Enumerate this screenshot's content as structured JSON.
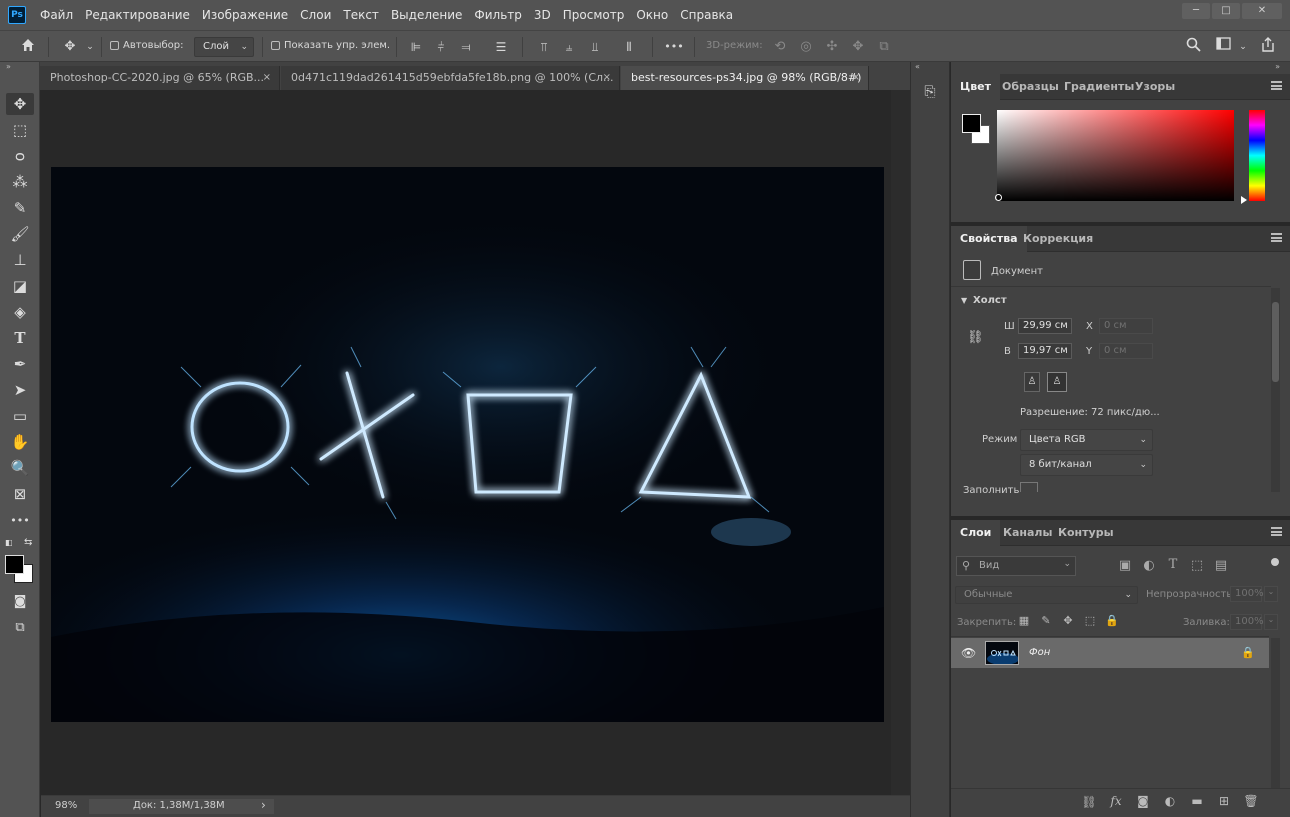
{
  "app": {
    "logo": "Ps"
  },
  "menubar": {
    "items": [
      "Файл",
      "Редактирование",
      "Изображение",
      "Слои",
      "Текст",
      "Выделение",
      "Фильтр",
      "3D",
      "Просмотр",
      "Окно",
      "Справка"
    ],
    "window_controls": [
      "minimize-icon",
      "maximize-icon",
      "close-icon"
    ]
  },
  "options": {
    "autoselect_label": "Автовыбор:",
    "autoselect_value": "Слой",
    "show_controls_label": "Показать упр. элем.",
    "more_label": "•••",
    "mode_3d_label": "3D-режим:"
  },
  "tabs": [
    {
      "label": "Photoshop-CC-2020.jpg @ 65% (RGB...",
      "close": "×"
    },
    {
      "label": "0d471c119dad261415d59ebfda5fe18b.png @ 100% (Сл...",
      "close": "×"
    },
    {
      "label": "best-resources-ps34.jpg @ 98% (RGB/8#)",
      "close": "×"
    }
  ],
  "status": {
    "zoom": "98%",
    "doc": "Док: 1,38M/1,38M",
    "arrow": "›"
  },
  "color_panel": {
    "tabs": [
      "Цвет",
      "Образцы",
      "Градиенты",
      "Узоры"
    ],
    "foreground": "#000000",
    "background": "#ffffff",
    "hue": "#ff0000"
  },
  "properties_panel": {
    "tabs": [
      "Свойства",
      "Коррекция"
    ],
    "doc_label": "Документ",
    "canvas_section": "Холст",
    "w_label": "Ш",
    "w_value": "29,99 см",
    "h_label": "В",
    "h_value": "19,97 см",
    "x_label": "X",
    "x_placeholder": "0 см",
    "y_label": "Y",
    "y_placeholder": "0 см",
    "resolution": "Разрешение: 72 пикс/дю...",
    "mode_label": "Режим",
    "mode_value": "Цвета RGB",
    "depth_value": "8 бит/канал",
    "fill_label": "Заполнить"
  },
  "layers_panel": {
    "tabs": [
      "Слои",
      "Каналы",
      "Контуры"
    ],
    "filter_placeholder": "Вид",
    "blend_mode": "Обычные",
    "opacity_label": "Непрозрачность:",
    "opacity_value": "100%",
    "lock_label": "Закрепить:",
    "fill_label": "Заливка:",
    "fill_value": "100%",
    "layers": [
      {
        "name": "Фон",
        "visible": true,
        "locked": true
      }
    ]
  }
}
